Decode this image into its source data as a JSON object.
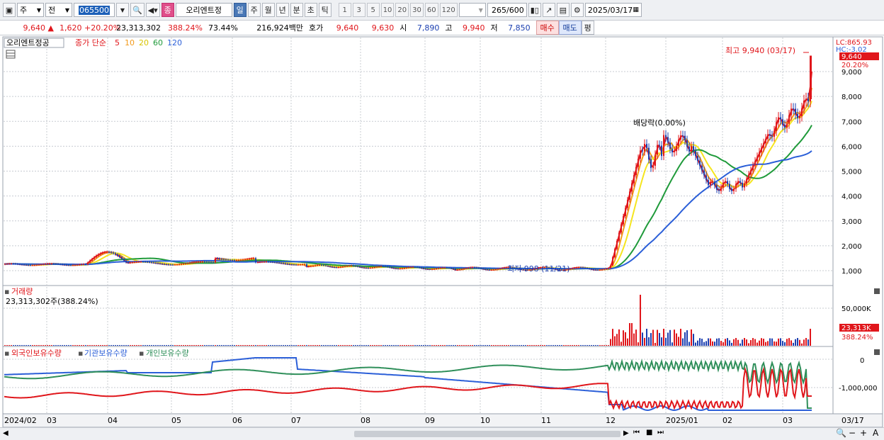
{
  "toolbar": {
    "market_type": "주",
    "period_type": "전",
    "stock_code": "065500",
    "stock_badge": "종",
    "stock_name": "오리엔트정",
    "periods": [
      "일",
      "주",
      "월",
      "년",
      "분",
      "초",
      "틱"
    ],
    "active_period": "일",
    "intervals": [
      "1",
      "3",
      "5",
      "10",
      "20",
      "30",
      "60",
      "120"
    ],
    "count_current": "265",
    "count_total": "/600",
    "date": "2025/03/17"
  },
  "quote": {
    "price": "9,640",
    "arrow": "▲",
    "change": "1,620",
    "change_pct": "+20.20%",
    "volume": "23,313,302",
    "volume_ratio": "388.24%",
    "turnover": "73.44%",
    "trade_amount": "216,924백만",
    "bid_label": "호가",
    "ask_price": "9,640",
    "bid_price": "9,630",
    "open_label": "시",
    "open": "7,890",
    "high_label": "고",
    "high": "9,940",
    "low_label": "저",
    "low": "7,850",
    "buy_label": "매수",
    "sell_label": "매도",
    "eval_label": "평"
  },
  "price_panel": {
    "stock_label": "오리엔트정공",
    "ma_label": "종가 단순",
    "ma_periods": [
      "5",
      "10",
      "20",
      "60",
      "120"
    ],
    "lc_label": "LC:865.93",
    "hc_label": "HC:-3.02",
    "current_tag": "9,640",
    "pct_tag": "20.20%",
    "high_annotation": "최고 9,940 (03/17)",
    "low_annotation": "최저 998 (11/21)",
    "dividend_annotation": "배당락(0.00%)",
    "y_ticks": [
      "9,000",
      "8,000",
      "7,000",
      "6,000",
      "5,000",
      "4,000",
      "3,000",
      "2,000",
      "1,000"
    ]
  },
  "volume_panel": {
    "title": "거래량",
    "value_text": "23,313,302주(388.24%)",
    "y_tick": "50,000K",
    "current_tag": "23,313K",
    "pct_tag": "388.24%"
  },
  "holding_panel": {
    "legends": [
      "외국인보유수량",
      "기관보유수량",
      "개인보유수량"
    ],
    "y_ticks": [
      "0",
      "-1,000,000"
    ]
  },
  "x_axis": {
    "labels": [
      "2024/02",
      "03",
      "04",
      "05",
      "06",
      "07",
      "08",
      "09",
      "10",
      "11",
      "12",
      "2025/01",
      "02",
      "03"
    ],
    "right_label": "03/17"
  },
  "colors": {
    "ma5": "#e0161b",
    "ma10": "#f29a1b",
    "ma20": "#f5e51e",
    "ma60": "#1f9a3a",
    "ma120": "#2b5fd8",
    "foreign": "#e0161b",
    "institution": "#2b5fd8",
    "individual": "#2f8f5a",
    "up": "#e0161b",
    "down": "#1b3fb0"
  }
}
